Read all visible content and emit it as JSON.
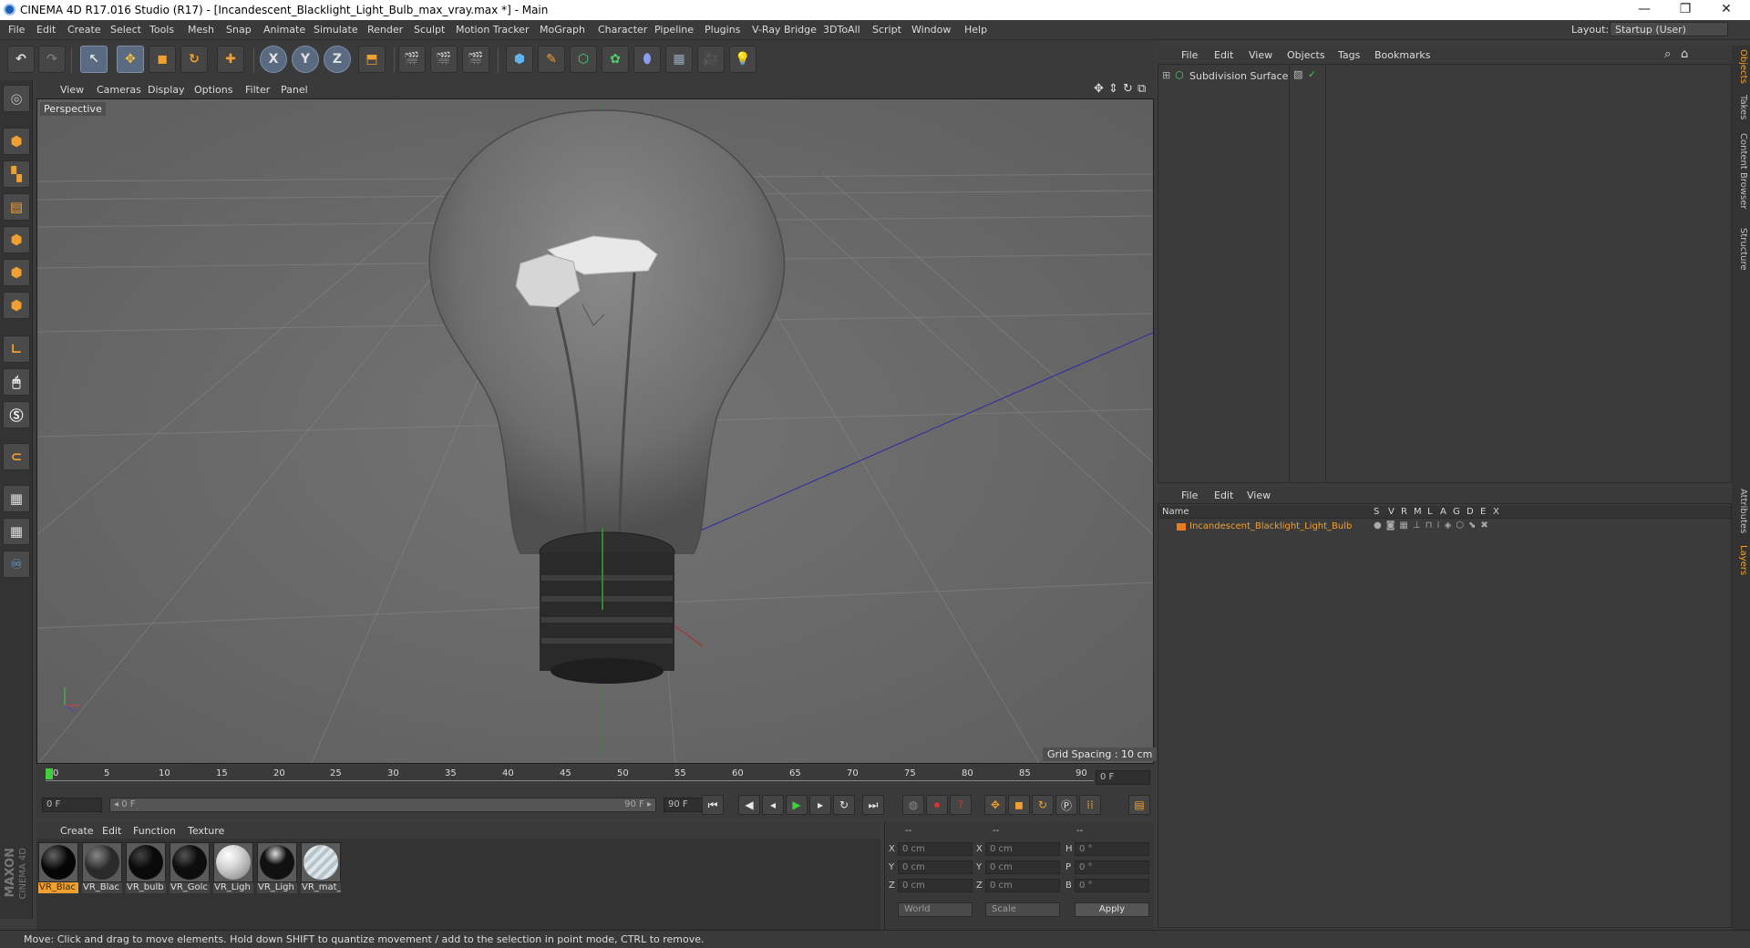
{
  "window": {
    "title": "CINEMA 4D R17.016 Studio (R17) - [Incandescent_Blacklight_Light_Bulb_max_vray.max *] - Main",
    "minimize": "—",
    "restore": "❐",
    "close": "✕"
  },
  "menubar": [
    "File",
    "Edit",
    "Create",
    "Select",
    "Tools",
    "Mesh",
    "Snap",
    "Animate",
    "Simulate",
    "Render",
    "Sculpt",
    "Motion Tracker",
    "MoGraph",
    "Character",
    "Pipeline",
    "Plugins",
    "V-Ray Bridge",
    "3DToAll",
    "Script",
    "Window",
    "Help"
  ],
  "layout": {
    "label": "Layout:",
    "value": "Startup (User)"
  },
  "toolbar": {
    "undo": "↶",
    "redo": "↷",
    "select": "↖",
    "move": "✥",
    "scale": "◼",
    "rotate": "↻",
    "add": "✚",
    "x": "X",
    "y": "Y",
    "z": "Z"
  },
  "viewport": {
    "menu": [
      "View",
      "Cameras",
      "Display",
      "Options",
      "Filter",
      "Panel"
    ],
    "label": "Perspective",
    "grid_spacing": "Grid Spacing : 10 cm"
  },
  "timeline": {
    "ticks": [
      "0",
      "5",
      "10",
      "15",
      "20",
      "25",
      "30",
      "35",
      "40",
      "45",
      "50",
      "55",
      "60",
      "65",
      "70",
      "75",
      "80",
      "85",
      "90"
    ],
    "frame_field": "0 F",
    "start_field": "0 F",
    "range_start": "◂ 0 F",
    "range_end": "90 F ▸",
    "end_field": "90 F",
    "end_field2": "90 F"
  },
  "materials": {
    "menu": [
      "Create",
      "Edit",
      "Function",
      "Texture"
    ],
    "items": [
      {
        "label": "VR_Blac",
        "color": "#050505",
        "selected": true
      },
      {
        "label": "VR_Blac",
        "color": "#2a2a2a",
        "selected": false
      },
      {
        "label": "VR_bulb",
        "color": "#0a0a0a",
        "selected": false
      },
      {
        "label": "VR_Golc",
        "color": "#0d0d0d",
        "selected": false
      },
      {
        "label": "VR_Ligh",
        "color": "#d8d8d8",
        "selected": false
      },
      {
        "label": "VR_Ligh",
        "color": "#111111",
        "selected": false
      },
      {
        "label": "VR_mat_",
        "color": "#b8c4cc",
        "selected": false
      }
    ]
  },
  "coords": {
    "headers": [
      "--",
      "--",
      "--"
    ],
    "rows": [
      {
        "a": "X",
        "av": "0 cm",
        "b": "X",
        "bv": "0 cm",
        "c": "H",
        "cv": "0 °"
      },
      {
        "a": "Y",
        "av": "0 cm",
        "b": "Y",
        "bv": "0 cm",
        "c": "P",
        "cv": "0 °"
      },
      {
        "a": "Z",
        "av": "0 cm",
        "b": "Z",
        "bv": "0 cm",
        "c": "B",
        "cv": "0 °"
      }
    ],
    "world": "World",
    "scale": "Scale",
    "apply": "Apply"
  },
  "objects": {
    "menu": [
      "File",
      "Edit",
      "View",
      "Objects",
      "Tags",
      "Bookmarks"
    ],
    "items": [
      {
        "name": "Subdivision Surface"
      }
    ]
  },
  "layers": {
    "menu": [
      "File",
      "Edit",
      "View"
    ],
    "header_name": "Name",
    "columns": [
      "S",
      "V",
      "R",
      "M",
      "L",
      "A",
      "G",
      "D",
      "E",
      "X"
    ],
    "items": [
      {
        "name": "Incandescent_Blacklight_Light_Bulb",
        "color": "#e87b1e"
      }
    ]
  },
  "right_tabs": [
    "Objects",
    "Takes",
    "Content Browser",
    "Structure",
    "Attributes",
    "Layers"
  ],
  "status": "Move: Click and drag to move elements. Hold down SHIFT to quantize movement / add to the selection in point mode, CTRL to remove.",
  "brand": {
    "line1": "MAXON",
    "line2": "CINEMA 4D"
  }
}
